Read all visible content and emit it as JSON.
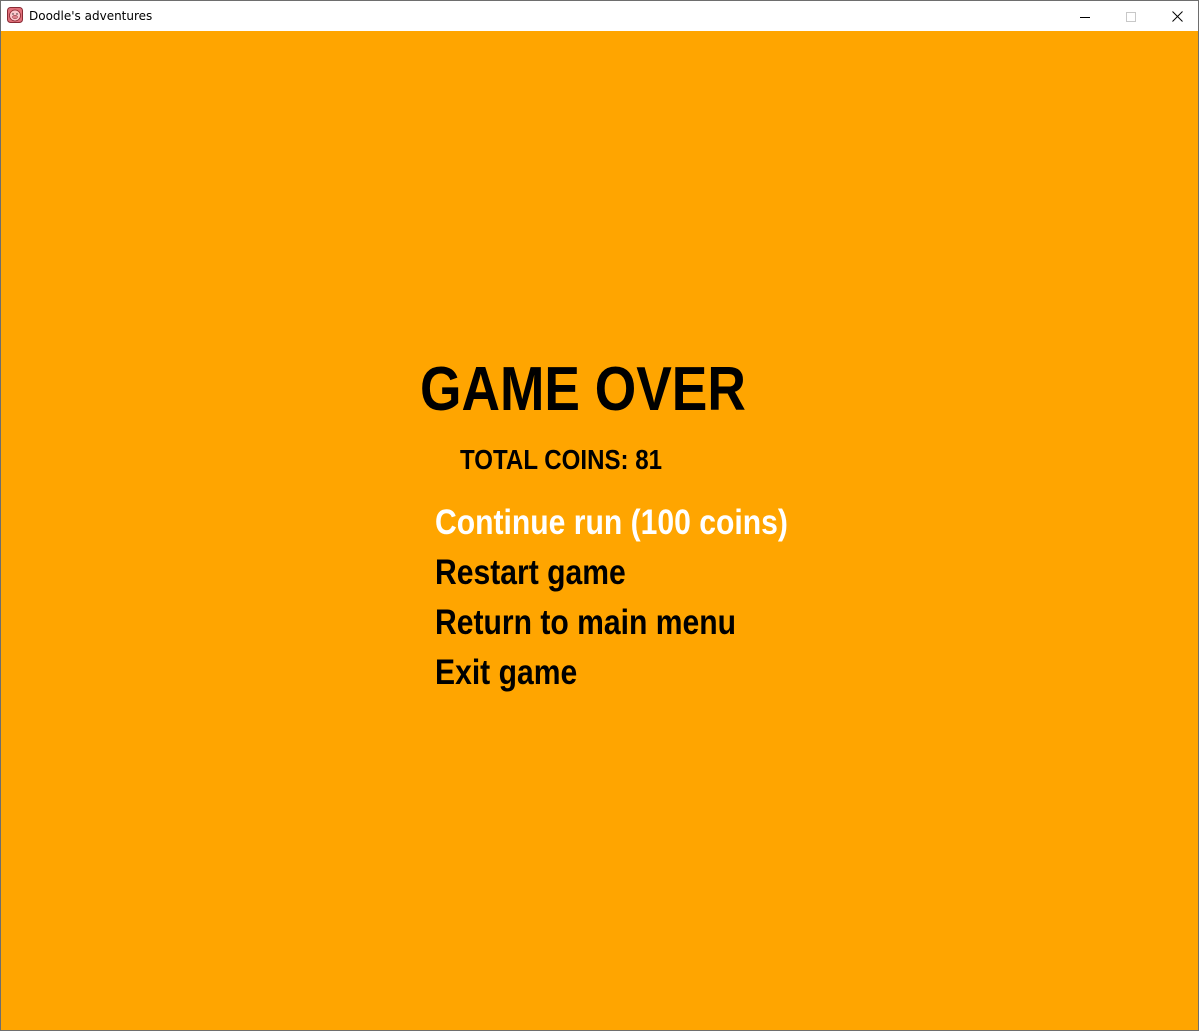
{
  "window": {
    "title": "Doodle's adventures",
    "icon": "pig-face-icon",
    "controls": [
      "minimize-icon",
      "maximize-icon",
      "close-icon"
    ]
  },
  "game": {
    "background_color": "#ffa500",
    "title": "GAME OVER",
    "coins_text": "TOTAL COINS: 81",
    "menu": [
      {
        "label": "Continue run (100 coins)",
        "selected": true
      },
      {
        "label": "Restart game",
        "selected": false
      },
      {
        "label": "Return to main menu",
        "selected": false
      },
      {
        "label": "Exit game",
        "selected": false
      }
    ],
    "selected_color": "#ffffff",
    "normal_color": "#000000"
  }
}
